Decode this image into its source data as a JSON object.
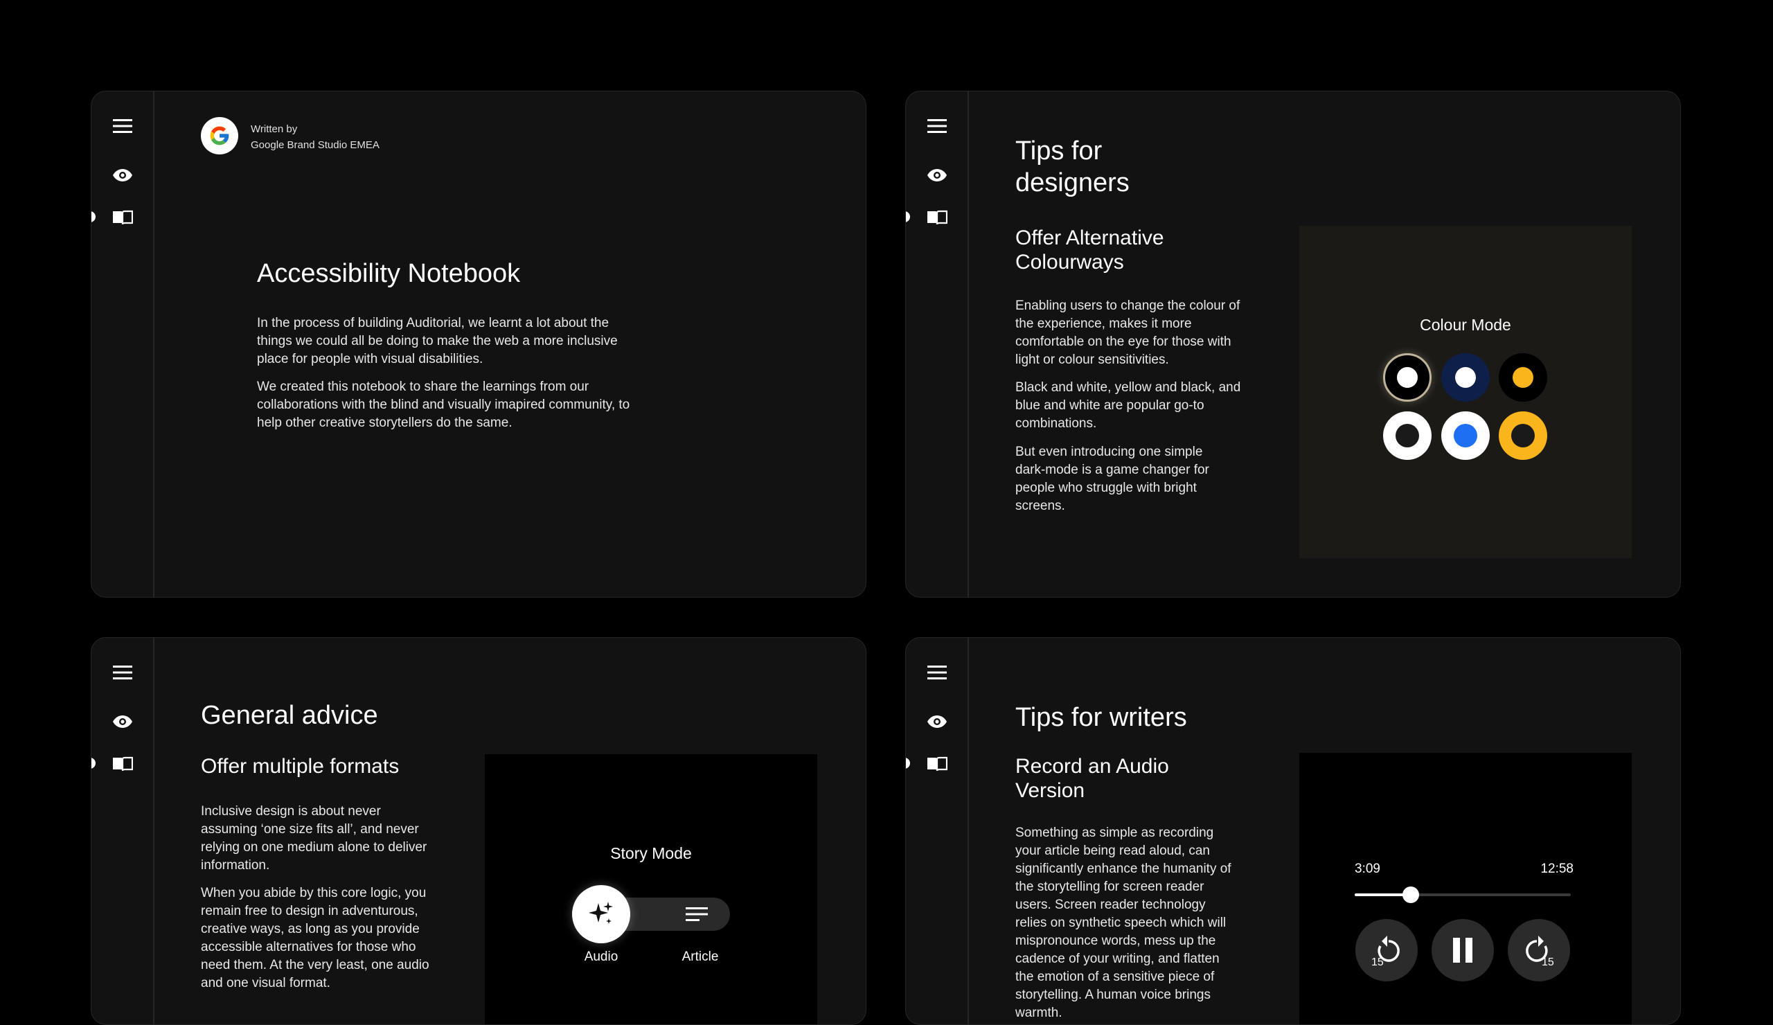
{
  "nav": {
    "menu_icon": "hamburger-menu-icon",
    "eye_icon": "eye-icon",
    "book_icon": "open-book-icon"
  },
  "card_notebook": {
    "written_by_label": "Written by",
    "author": "Google Brand Studio EMEA",
    "title": "Accessibility Notebook",
    "para1": "In the process of building Auditorial, we learnt a lot about the things we could all be doing to make the web a more inclusive place for people with visual disabilities.",
    "para2": "We created this notebook to share the learnings from our collaborations with the blind and visually imapired community, to help other creative storytellers do the same."
  },
  "card_designers": {
    "title": "Tips for designers",
    "subtitle": "Offer Alternative Colourways",
    "para1": "Enabling users to change the colour of the experience, makes it more comfortable on the eye for those with light or colour sensitivities.",
    "para2": "Black and white, yellow and black, and blue and white are popular go-to combinations.",
    "para3": "But even introducing one simple dark-mode is a game changer for people who struggle with bright screens.",
    "colour_mode_label": "Colour Mode",
    "swatches": [
      {
        "name": "white-on-black",
        "ring": "#000000",
        "dot": "#ffffff",
        "selected": true
      },
      {
        "name": "white-on-navy",
        "ring": "#0e1f4a",
        "dot": "#ffffff",
        "selected": false
      },
      {
        "name": "yellow-on-black",
        "ring": "#000000",
        "dot": "#f9b51b",
        "selected": false
      },
      {
        "name": "black-on-white",
        "ring": "#ffffff",
        "dot": "#1a1a1a",
        "selected": false
      },
      {
        "name": "blue-on-white",
        "ring": "#ffffff",
        "dot": "#1f6ff2",
        "selected": false
      },
      {
        "name": "black-on-yellow",
        "ring": "#f9b51b",
        "dot": "#1a1a1a",
        "selected": false
      }
    ]
  },
  "card_general": {
    "title": "General advice",
    "subtitle": "Offer multiple formats",
    "para1": "Inclusive design is about never assuming ‘one size fits all’, and never relying on one medium alone to deliver information.",
    "para2": "When you abide by this core logic, you remain free to design in adventurous, creative ways, as long as you provide accessible alternatives for those who need them. At the very least, one audio and one visual format.",
    "story_mode_label": "Story Mode",
    "audio_label": "Audio",
    "article_label": "Article",
    "audio_icon": "sparkle-icon",
    "article_icon": "text-lines-icon"
  },
  "card_writers": {
    "title": "Tips for writers",
    "subtitle": "Record an Audio Version",
    "para1": "Something as simple as recording your article being read aloud, can significantly enhance the humanity of the storytelling for screen reader users. Screen reader technology relies on synthetic speech which will mispronounce words, mess up the cadence of your writing, and flatten the emotion of a sensitive piece of storytelling. A human voice brings warmth.",
    "time_current": "3:09",
    "time_total": "12:58",
    "progress": 0.26,
    "rewind_label": "15",
    "forward_label": "15"
  }
}
